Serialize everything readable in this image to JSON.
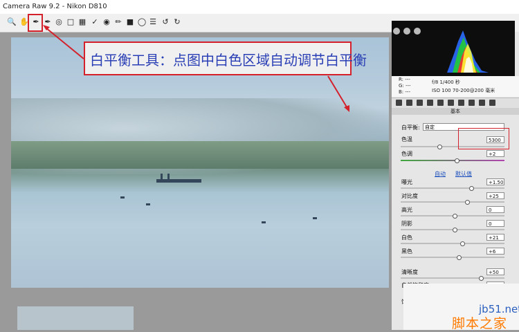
{
  "window": {
    "title": "Camera Raw 9.2 -  Nikon D810"
  },
  "annotation": {
    "text": "白平衡工具：点图中白色区域自动调节白平衡"
  },
  "camera_info": {
    "r": "R:  ---",
    "g": "G:  ---",
    "b": "B:  ---",
    "aperture_shutter": "f/8  1/400 秒",
    "iso_lens": "ISO 100   70-200@200 毫米"
  },
  "panel": {
    "title": "基本",
    "white_balance_label": "白平衡:",
    "white_balance_value": "自定",
    "temperature_label": "色温",
    "temperature_value": "5300",
    "tint_label": "色调",
    "tint_value": "+2",
    "auto_label": "自动",
    "default_label": "默认值",
    "exposure_label": "曝光",
    "exposure_value": "+1.50",
    "contrast_label": "对比度",
    "contrast_value": "+25",
    "highlights_label": "高光",
    "highlights_value": "0",
    "shadows_label": "阴影",
    "shadows_value": "0",
    "whites_label": "白色",
    "whites_value": "+21",
    "blacks_label": "黑色",
    "blacks_value": "+6",
    "clarity_label": "清晰度",
    "clarity_value": "+50",
    "vibrance_label": "自然饱和度",
    "vibrance_value": "+50",
    "saturation_label": "饱"
  },
  "sliders": {
    "temperature": 0.35,
    "tint": 0.52,
    "exposure": 0.66,
    "contrast": 0.62,
    "highlights": 0.5,
    "shadows": 0.5,
    "whites": 0.57,
    "blacks": 0.54,
    "clarity": 0.75
  },
  "watermark": {
    "site": "jb51.net",
    "name": "脚本之家"
  },
  "icons": [
    "zoom-icon",
    "hand-icon",
    "white-balance-icon",
    "color-sampler-icon",
    "target-adjust-icon",
    "crop-icon",
    "straighten-icon",
    "spot-removal-icon",
    "red-eye-icon",
    "adjust-brush-icon",
    "graduated-filter-icon",
    "radial-filter-icon",
    "preferences-icon",
    "rotate-left-icon",
    "rotate-right-icon"
  ]
}
